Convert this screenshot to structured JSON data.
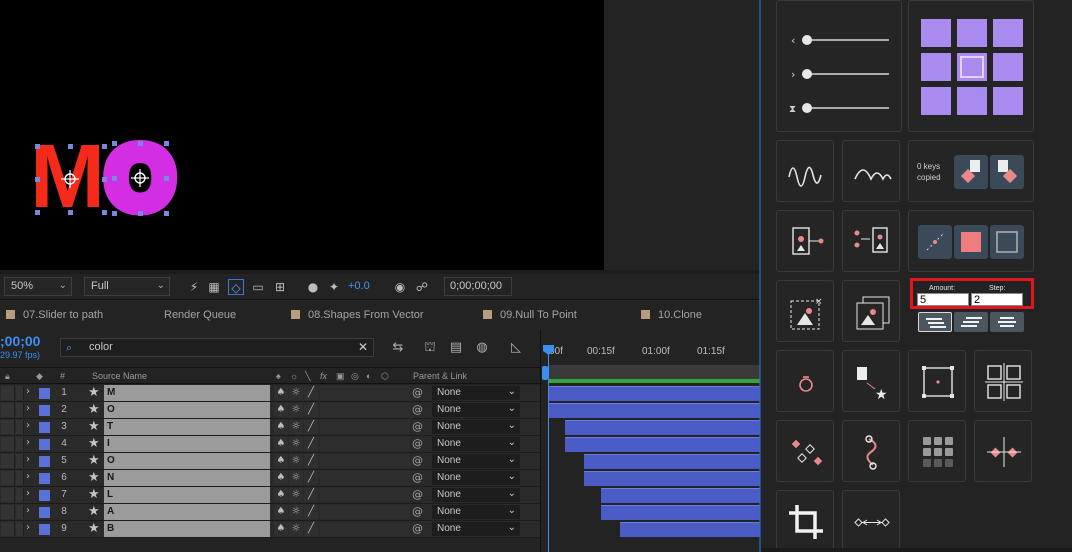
{
  "viewer": {
    "letters": [
      "M",
      "O"
    ],
    "colors": {
      "m": "#f52a1a",
      "o": "#d32ee3",
      "handles": "#7b86e0"
    }
  },
  "viewer_controls": {
    "zoom": "50%",
    "resolution": "Full",
    "exposure": "+0.0",
    "timecode": "0;00;00;00"
  },
  "tabs": [
    {
      "label": "07.Slider to path"
    },
    {
      "label": "Render Queue"
    },
    {
      "label": "08.Shapes From Vector"
    },
    {
      "label": "09.Null To Point"
    },
    {
      "label": "10.Clone"
    }
  ],
  "timeline": {
    "current_time": ";00;00",
    "fps": "29.97 fps)",
    "search_value": "color",
    "columns": {
      "num": "#",
      "source_name": "Source Name",
      "parent": "Parent & Link",
      "fx": "fx"
    },
    "ruler": [
      "00f",
      "00:15f",
      "01:00f",
      "01:15f"
    ],
    "accent": "#3a8ff0",
    "bar_color": "#4c5cc7"
  },
  "layers": [
    {
      "num": "1",
      "name": "M",
      "parent": "None",
      "bar_start": 0.0
    },
    {
      "num": "2",
      "name": "O",
      "parent": "None",
      "bar_start": 0.0
    },
    {
      "num": "3",
      "name": "T",
      "parent": "None",
      "bar_start": 0.08
    },
    {
      "num": "4",
      "name": "I",
      "parent": "None",
      "bar_start": 0.08
    },
    {
      "num": "5",
      "name": "O",
      "parent": "None",
      "bar_start": 0.17
    },
    {
      "num": "6",
      "name": "N",
      "parent": "None",
      "bar_start": 0.17
    },
    {
      "num": "7",
      "name": "L",
      "parent": "None",
      "bar_start": 0.25
    },
    {
      "num": "8",
      "name": "A",
      "parent": "None",
      "bar_start": 0.25
    },
    {
      "num": "9",
      "name": "B",
      "parent": "None",
      "bar_start": 0.34
    }
  ],
  "panel": {
    "keys_copied_line1": "0 keys",
    "keys_copied_line2": "copied",
    "amount_label": "Amount:",
    "step_label": "Step:",
    "amount_value": "5",
    "step_value": "2",
    "grid_color": "#a98bf0",
    "highlight_color": "#e1161c"
  }
}
